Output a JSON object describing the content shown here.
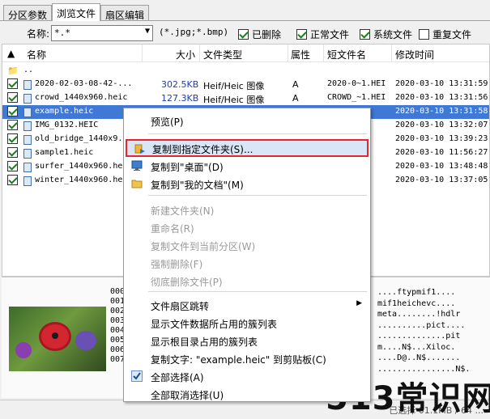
{
  "tabs": [
    "分区参数",
    "浏览文件",
    "扇区编辑"
  ],
  "filter": {
    "name_label": "名称:",
    "name_value": "*.*",
    "ext_hint": "(*.jpg;*.bmp)",
    "checks": [
      {
        "label": "已删除",
        "checked": true
      },
      {
        "label": "正常文件",
        "checked": true
      },
      {
        "label": "系统文件",
        "checked": true
      },
      {
        "label": "重复文件",
        "checked": false
      }
    ]
  },
  "columns": [
    "名称",
    "大小",
    "文件类型",
    "属性",
    "短文件名",
    "修改时间"
  ],
  "parent_dir": "..",
  "files": [
    {
      "name": "2020-02-03-08-42-...",
      "size": "302.5KB",
      "type": "Heif/Heic 图像",
      "attr": "A",
      "short": "2020-0~1.HEI",
      "modified": "2020-03-10 13:31:59"
    },
    {
      "name": "crowd_1440x960.heic",
      "size": "127.3KB",
      "type": "Heif/Heic 图像",
      "attr": "A",
      "short": "CROWD_~1.HEI",
      "modified": "2020-03-10 13:31:56"
    },
    {
      "name": "example.heic",
      "size": "",
      "type": "",
      "attr": "",
      "short": "",
      "modified": "2020-03-10 13:31:58",
      "selected": true
    },
    {
      "name": "IMG_0132.HEIC",
      "size": "",
      "type": "",
      "attr": "",
      "short": "HEI",
      "modified": "2020-03-10 13:32:07"
    },
    {
      "name": "old_bridge_1440x9...",
      "size": "",
      "type": "",
      "attr": "",
      "short": "HEI",
      "modified": "2020-03-10 13:39:23"
    },
    {
      "name": "sample1.heic",
      "size": "",
      "type": "",
      "attr": "",
      "short": "HEI",
      "modified": "2020-03-10 11:56:27"
    },
    {
      "name": "surfer_1440x960.he",
      "size": "",
      "type": "",
      "attr": "",
      "short": "HEI",
      "modified": "2020-03-10 13:48:48"
    },
    {
      "name": "winter_1440x960.he",
      "size": "",
      "type": "",
      "attr": "",
      "short": "HEI",
      "modified": "2020-03-10 13:37:05"
    }
  ],
  "preview": {
    "offsets": [
      "000",
      "001",
      "002",
      "003",
      "004",
      "005",
      "006",
      "007"
    ],
    "ascii": [
      "....ftypmif1....",
      "mif1heichevc....",
      "meta........!hdlr",
      "..........pict....",
      "..............pit",
      "m....N$...Xiloc.",
      "....D@..N$.......",
      "................N$."
    ]
  },
  "context_menu": [
    {
      "label": "预览(P)",
      "icon": "",
      "disabled": false
    },
    {
      "label": "复制到指定文件夹(S)...",
      "icon": "copy-icon",
      "disabled": false,
      "highlighted": true
    },
    {
      "label": "复制到\"桌面\"(D)",
      "icon": "desktop-icon",
      "disabled": false
    },
    {
      "label": "复制到\"我的文档\"(M)",
      "icon": "folder-icon",
      "disabled": false
    },
    {
      "label": "新建文件夹(N)",
      "icon": "",
      "disabled": true
    },
    {
      "label": "重命名(R)",
      "icon": "",
      "disabled": true
    },
    {
      "label": "复制文件到当前分区(W)",
      "icon": "",
      "disabled": true
    },
    {
      "label": "强制删除(F)",
      "icon": "",
      "disabled": true
    },
    {
      "label": "彻底删除文件(P)",
      "icon": "",
      "disabled": true
    },
    {
      "label": "文件扇区跳转",
      "icon": "",
      "disabled": false,
      "submenu": true
    },
    {
      "label": "显示文件数据所占用的簇列表",
      "icon": "",
      "disabled": false
    },
    {
      "label": "显示根目录占用的簇列表",
      "icon": "",
      "disabled": false
    },
    {
      "label": "复制文字: \"example.heic\" 到剪贴板(C)",
      "icon": "",
      "disabled": false
    },
    {
      "label": "全部选择(A)",
      "icon": "check-icon",
      "disabled": false
    },
    {
      "label": "全部取消选择(U)",
      "icon": "",
      "disabled": false
    }
  ],
  "status": "已选择 01.1MB / 64 ...",
  "watermark": "513常识网",
  "colors": {
    "selection": "#3f79d5",
    "highlight_border": "#e8252a",
    "size_text": "#1d3fa8"
  }
}
